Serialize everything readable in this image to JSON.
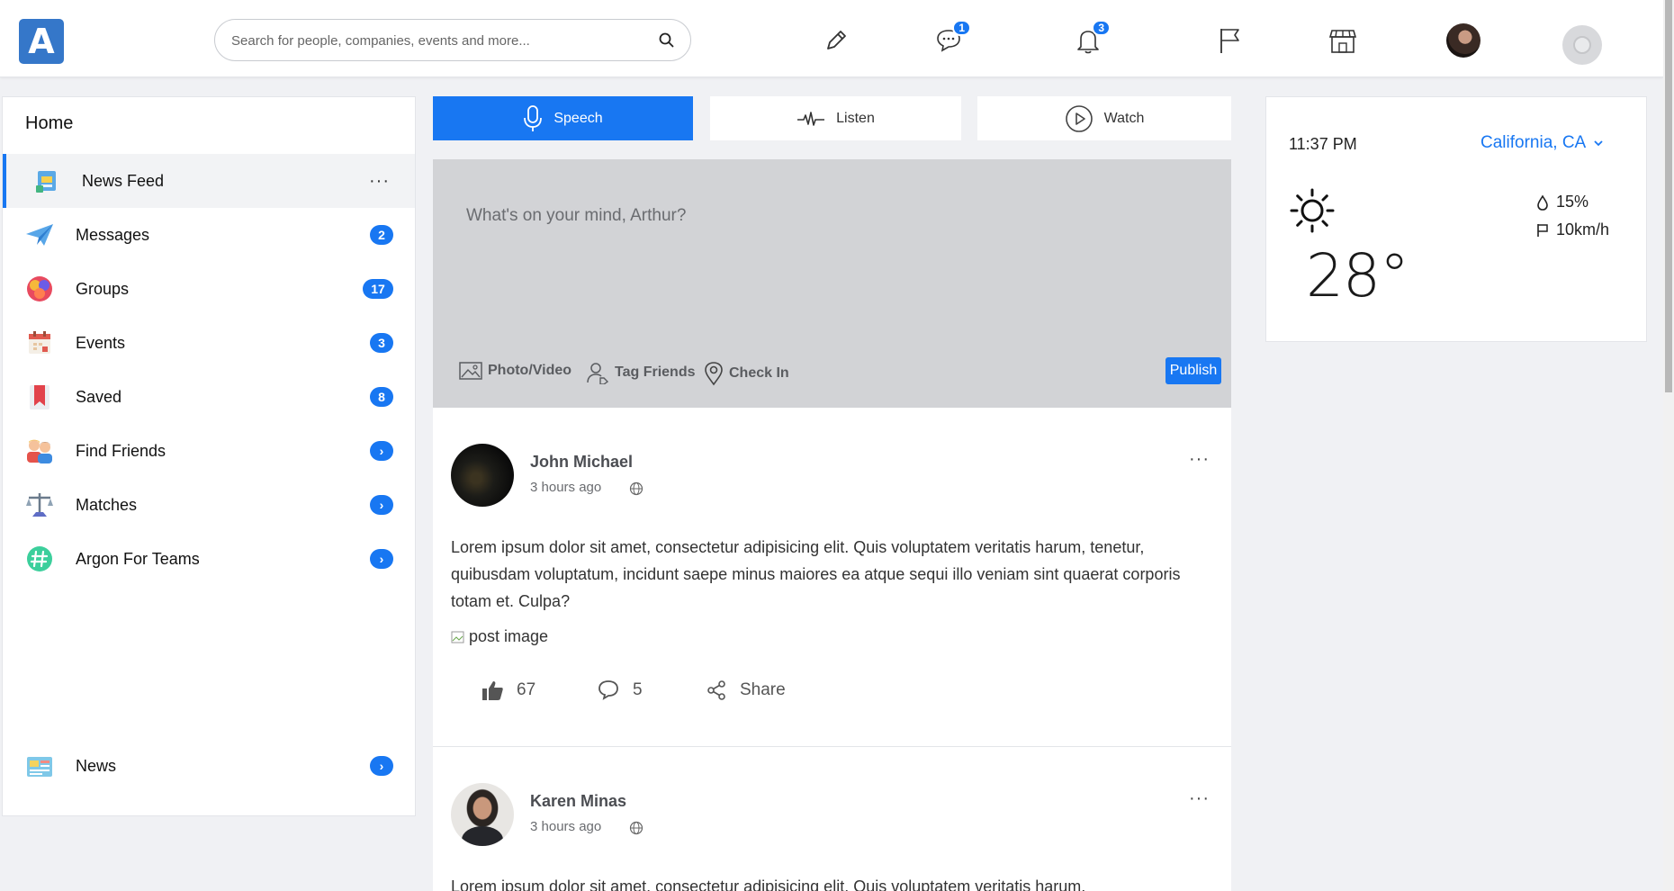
{
  "brand": {
    "logo_letter": "A"
  },
  "search": {
    "placeholder": "Search for people, companies, events and more..."
  },
  "topnav": {
    "messages_badge": "1",
    "notifications_badge": "3"
  },
  "sidebar": {
    "title": "Home",
    "items": [
      {
        "label": "News Feed",
        "badge": "",
        "more": "···"
      },
      {
        "label": "Messages",
        "badge": "2"
      },
      {
        "label": "Groups",
        "badge": "17"
      },
      {
        "label": "Events",
        "badge": "3"
      },
      {
        "label": "Saved",
        "badge": "8"
      },
      {
        "label": "Find Friends",
        "badge": "›"
      },
      {
        "label": "Matches",
        "badge": "›"
      },
      {
        "label": "Argon For Teams",
        "badge": "›"
      },
      {
        "label": "News",
        "badge": "›"
      }
    ]
  },
  "tabs": [
    {
      "label": "Speech",
      "active": true
    },
    {
      "label": "Listen",
      "active": false
    },
    {
      "label": "Watch",
      "active": false
    }
  ],
  "composer": {
    "placeholder": "What's on your mind, Arthur?",
    "actions": [
      "Photo/Video",
      "Tag Friends",
      "Check In"
    ],
    "publish_label": "Publish"
  },
  "posts": [
    {
      "author": "John Michael",
      "time": "3 hours ago",
      "more": "···",
      "text": "Lorem ipsum dolor sit amet, consectetur adipisicing elit. Quis voluptatem veritatis harum, tenetur, quibusdam voluptatum, incidunt saepe minus maiores ea atque sequi illo veniam sint quaerat corporis totam et. Culpa?",
      "image_alt": "post image",
      "likes": "67",
      "comments": "5",
      "share_label": "Share"
    },
    {
      "author": "Karen Minas",
      "time": "3 hours ago",
      "more": "···",
      "text": "Lorem ipsum dolor sit amet, consectetur adipisicing elit. Quis voluptatem veritatis harum,"
    }
  ],
  "weather": {
    "time": "11:37 PM",
    "location": "California, CA",
    "temperature": "28°",
    "humidity": "15%",
    "wind": "10km/h"
  },
  "colors": {
    "accent": "#1877f2",
    "logo": "#3577c9",
    "composer_bg": "#d2d3d6"
  }
}
